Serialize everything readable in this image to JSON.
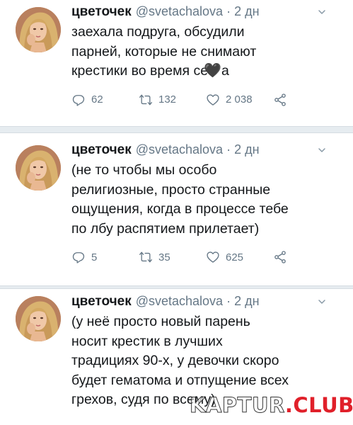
{
  "tweets": [
    {
      "name": "цветочек",
      "handle": "@svetachalova",
      "dot": "·",
      "time": "2 дн",
      "text": "заехала подруга, обсудили\nпарней, которые не снимают\nкрестики во время се",
      "text_tail": "а",
      "emoji": "🖤",
      "replies": "62",
      "retweets": "132",
      "likes": "2 038"
    },
    {
      "name": "цветочек",
      "handle": "@svetachalova",
      "dot": "·",
      "time": "2 дн",
      "text": "(не то чтобы мы особо\nрелигиозные, просто странные\nощущения, когда в процессе тебе\nпо лбу распятием прилетает)",
      "replies": "5",
      "retweets": "35",
      "likes": "625"
    },
    {
      "name": "цветочек",
      "handle": "@svetachalova",
      "dot": "·",
      "time": "2 дн",
      "text": "(у неё просто новый парень\nносит крестик в лучших\nтрадициях 90-х, у девочки скоро\nбудет гематома и отпущение всех\nгрехов, судя по всему)"
    }
  ],
  "icons": {
    "reply": "reply-icon",
    "retweet": "retweet-icon",
    "like": "heart-icon",
    "share": "share-icon",
    "menu": "chevron-down-icon"
  },
  "watermark": {
    "main": "KAPTUR",
    "club": ".CLUB"
  },
  "colors": {
    "text": "#14171a",
    "secondary": "#657786",
    "divider": "#e6ecf0",
    "watermark_red": "#e0202a"
  }
}
